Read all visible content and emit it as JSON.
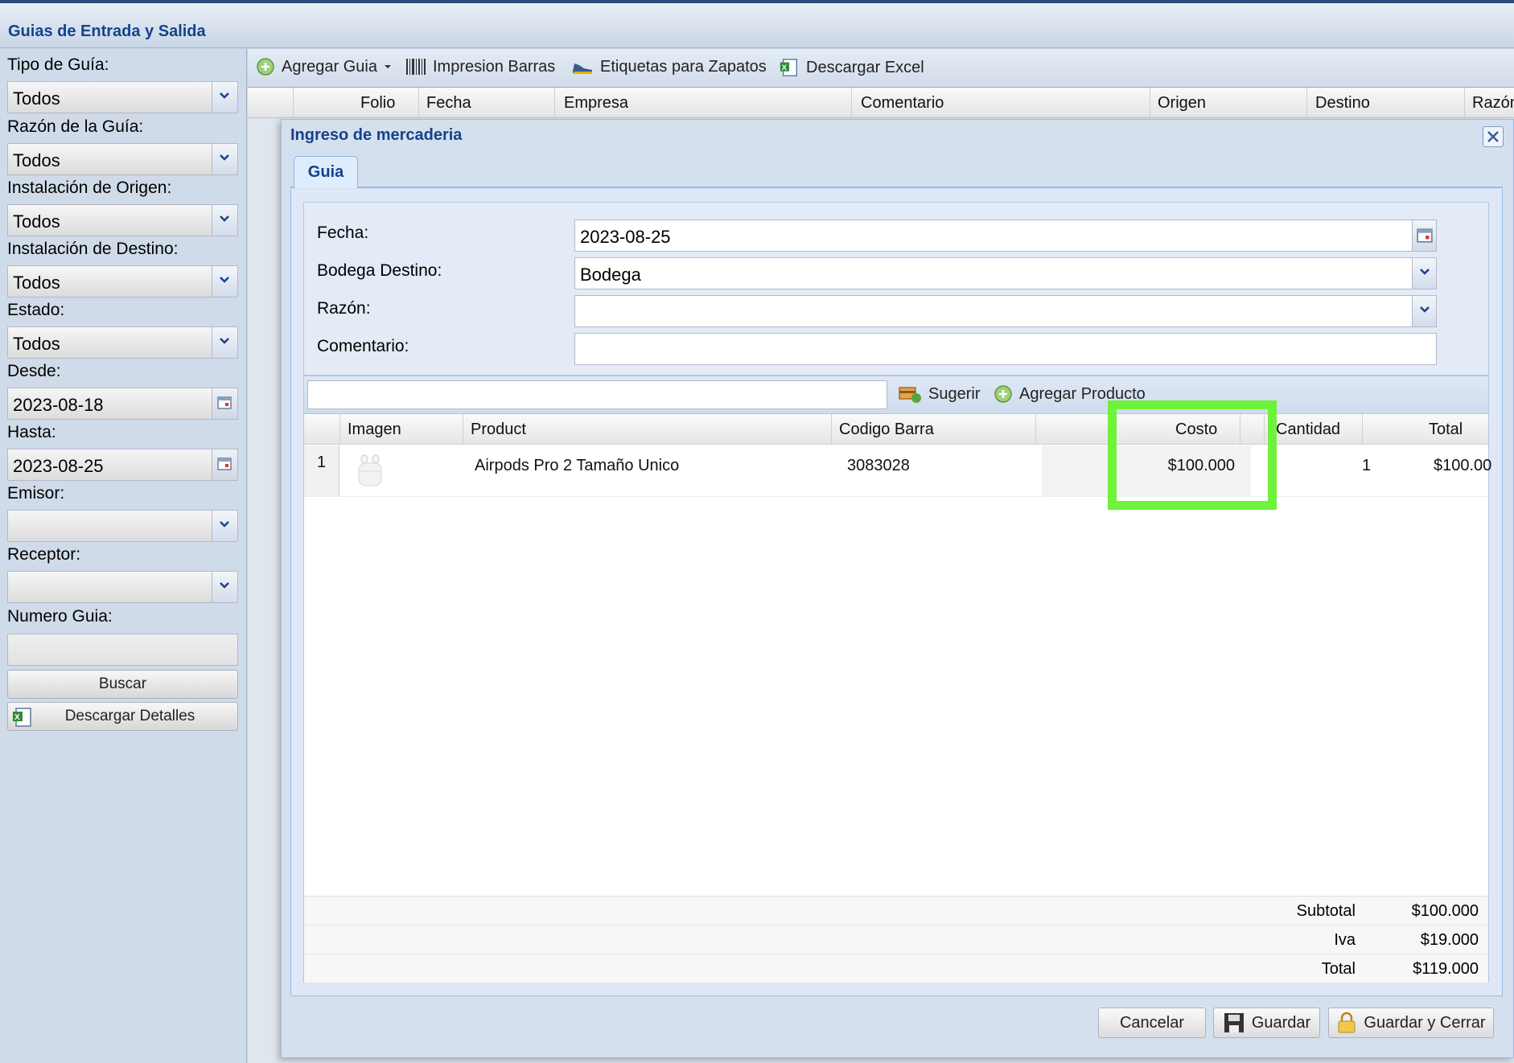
{
  "panel": {
    "title": "Guias de Entrada y Salida"
  },
  "filters": {
    "tipo_label": "Tipo de Guía:",
    "tipo_value": "Todos",
    "razon_label": "Razón de la Guía:",
    "razon_value": "Todos",
    "origen_label": "Instalación de Origen:",
    "origen_value": "Todos",
    "destino_label": "Instalación de Destino:",
    "destino_value": "Todos",
    "estado_label": "Estado:",
    "estado_value": "Todos",
    "desde_label": "Desde:",
    "desde_value": "2023-08-18",
    "hasta_label": "Hasta:",
    "hasta_value": "2023-08-25",
    "emisor_label": "Emisor:",
    "emisor_value": "",
    "receptor_label": "Receptor:",
    "receptor_value": "",
    "numero_label": "Numero Guia:",
    "numero_value": "",
    "buscar_label": "Buscar",
    "descargar_detalles_label": "Descargar Detalles"
  },
  "toolbar": {
    "agregar_guia": "Agregar Guia",
    "impresion_barras": "Impresion Barras",
    "etiquetas": "Etiquetas para Zapatos",
    "descargar_excel": "Descargar Excel"
  },
  "grid": {
    "columns": [
      "Folio",
      "Fecha",
      "Empresa",
      "Comentario",
      "Origen",
      "Destino",
      "Razón"
    ]
  },
  "modal": {
    "title": "Ingreso de mercaderia",
    "tab": "Guia",
    "form": {
      "fecha_label": "Fecha:",
      "fecha_value": "2023-08-25",
      "bodega_label": "Bodega Destino:",
      "bodega_value": "Bodega",
      "razon_label": "Razón:",
      "razon_value": "",
      "comentario_label": "Comentario:",
      "comentario_value": ""
    },
    "products_toolbar": {
      "sugerir": "Sugerir",
      "agregar_producto": "Agregar Producto"
    },
    "products": {
      "columns": [
        "Imagen",
        "Product",
        "Codigo Barra",
        "Costo",
        "Cantidad",
        "Total"
      ],
      "rows": [
        {
          "num": "1",
          "product": "Airpods Pro 2 Tamaño Unico",
          "codigo": "3083028",
          "costo": "$100.000",
          "cantidad": "1",
          "total": "$100.00"
        }
      ]
    },
    "totals": {
      "subtotal_label": "Subtotal",
      "subtotal_value": "$100.000",
      "iva_label": "Iva",
      "iva_value": "$19.000",
      "total_label": "Total",
      "total_value": "$119.000"
    },
    "buttons": {
      "cancelar": "Cancelar",
      "guardar": "Guardar",
      "guardar_cerrar": "Guardar y Cerrar"
    }
  },
  "colors": {
    "highlight": "#6ff23a",
    "title_blue": "#15428b"
  }
}
